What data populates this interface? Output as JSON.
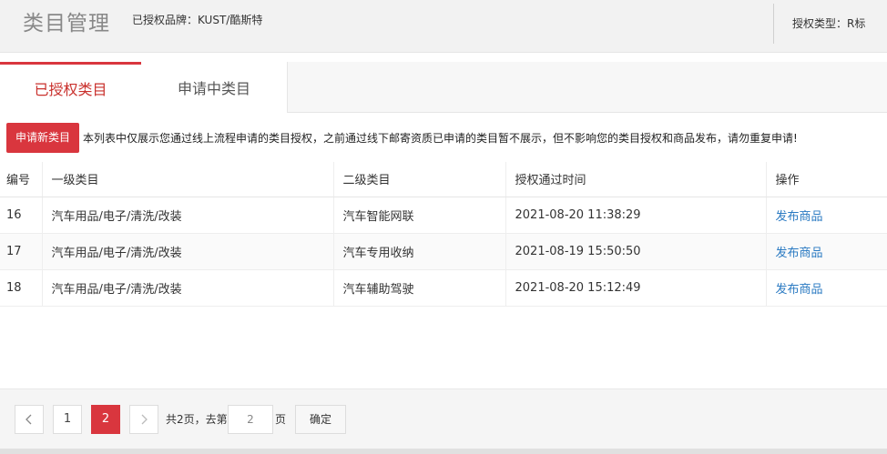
{
  "header": {
    "title": "类目管理",
    "brand": "已授权品牌：KUST/酷斯特",
    "auth_type": "授权类型：R标"
  },
  "tabs": [
    {
      "label": "已授权类目",
      "active": true
    },
    {
      "label": "申请中类目",
      "active": false
    }
  ],
  "toolbar": {
    "apply_label": "申请新类目",
    "notice": "本列表中仅展示您通过线上流程申请的类目授权，之前通过线下邮寄资质已申请的类目暂不展示，但不影响您的类目授权和商品发布，请勿重复申请!"
  },
  "table": {
    "headers": [
      "编号",
      "一级类目",
      "二级类目",
      "授权通过时间",
      "操作"
    ],
    "rows": [
      {
        "id": "16",
        "level1": "汽车用品/电子/清洗/改装",
        "level2": "汽车智能网联",
        "time": "2021-08-20 11:38:29",
        "action": "发布商品"
      },
      {
        "id": "17",
        "level1": "汽车用品/电子/清洗/改装",
        "level2": "汽车专用收纳",
        "time": "2021-08-19 15:50:50",
        "action": "发布商品"
      },
      {
        "id": "18",
        "level1": "汽车用品/电子/清洗/改装",
        "level2": "汽车辅助驾驶",
        "time": "2021-08-20 15:12:49",
        "action": "发布商品"
      }
    ]
  },
  "pagination": {
    "prev_icon": "chevron-left-icon",
    "next_icon": "chevron-right-icon",
    "pages": [
      "1",
      "2"
    ],
    "current_page": "2",
    "total_label": "共2页，去第",
    "goto_value": "2",
    "page_label": "页",
    "confirm_label": "确定"
  },
  "colors": {
    "accent": "#d9363e",
    "link": "#2a7ac2"
  }
}
